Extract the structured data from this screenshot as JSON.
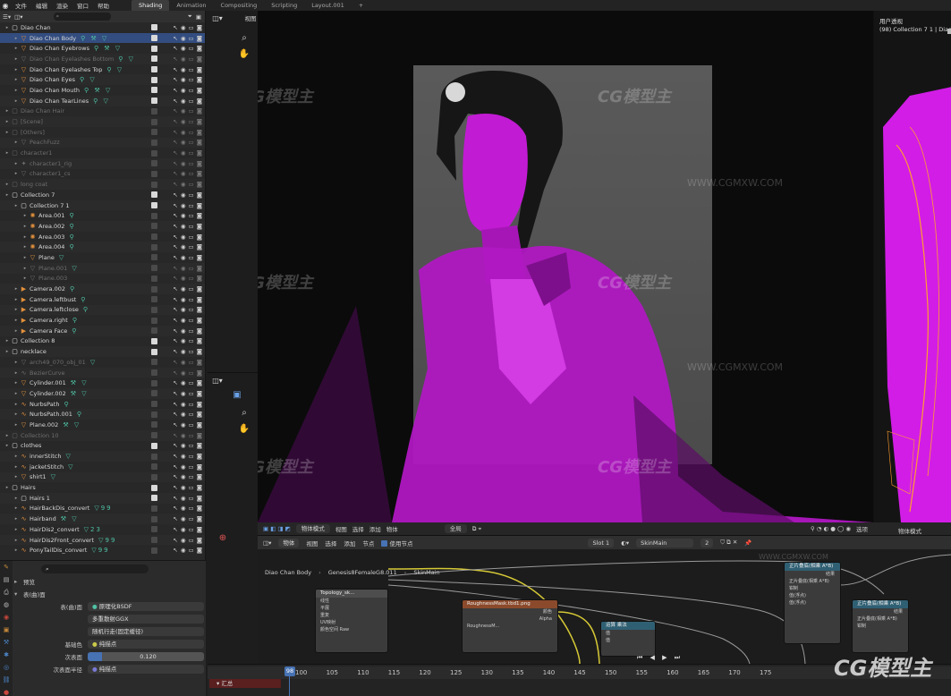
{
  "menu": [
    "文件",
    "编辑",
    "渲染",
    "窗口",
    "帮助"
  ],
  "workspaces": [
    "Shading",
    "Animation",
    "Compositing",
    "Scripting",
    "Layout.001",
    "+"
  ],
  "outliner": {
    "rows": [
      {
        "name": "Diao Chan",
        "level": 0,
        "kind": "collection",
        "dim": false,
        "check": true
      },
      {
        "name": "Diao Chan Body",
        "level": 1,
        "kind": "mesh",
        "dim": false,
        "check": true,
        "selected": true,
        "extras": "⚲ ⚒ ▽"
      },
      {
        "name": "Diao Chan Eyebrows",
        "level": 1,
        "kind": "mesh",
        "dim": false,
        "check": true,
        "extras": "⚲ ⚒ ▽"
      },
      {
        "name": "Diao Chan Eyelashes Bottom",
        "level": 1,
        "kind": "mesh",
        "dim": true,
        "check": true,
        "extras": "⚲ ▽"
      },
      {
        "name": "Diao Chan Eyelashes Top",
        "level": 1,
        "kind": "mesh",
        "dim": false,
        "check": true,
        "extras": "⚲ ▽"
      },
      {
        "name": "Diao Chan Eyes",
        "level": 1,
        "kind": "mesh",
        "dim": false,
        "check": true,
        "extras": "⚲ ▽"
      },
      {
        "name": "Diao Chan Mouth",
        "level": 1,
        "kind": "mesh",
        "dim": false,
        "check": true,
        "extras": "⚲ ⚒ ▽"
      },
      {
        "name": "Diao Chan TearLines",
        "level": 1,
        "kind": "mesh",
        "dim": false,
        "check": true,
        "extras": "⚲ ▽"
      },
      {
        "name": "Diao Chan Hair",
        "level": 0,
        "kind": "collection",
        "dim": true,
        "check": false
      },
      {
        "name": "[Scene]",
        "level": 0,
        "kind": "collection",
        "dim": true,
        "check": false
      },
      {
        "name": "[Others]",
        "level": 0,
        "kind": "collection",
        "dim": true,
        "check": false
      },
      {
        "name": "PeachFuzz",
        "level": 1,
        "kind": "mesh",
        "dim": true,
        "check": false
      },
      {
        "name": "character1",
        "level": 0,
        "kind": "collection",
        "dim": true,
        "check": false
      },
      {
        "name": "character1_rig",
        "level": 1,
        "kind": "armature",
        "dim": true,
        "check": false
      },
      {
        "name": "character1_cs",
        "level": 1,
        "kind": "mesh",
        "dim": true,
        "check": false
      },
      {
        "name": "long coat",
        "level": 0,
        "kind": "collection",
        "dim": true,
        "check": false
      },
      {
        "name": "Collection 7",
        "level": 0,
        "kind": "collection",
        "dim": false,
        "check": true
      },
      {
        "name": "Collection 7 1",
        "level": 1,
        "kind": "collection",
        "dim": false,
        "check": true
      },
      {
        "name": "Area.001",
        "level": 2,
        "kind": "light",
        "dim": false,
        "check": false,
        "extras": "⚲"
      },
      {
        "name": "Area.002",
        "level": 2,
        "kind": "light",
        "dim": false,
        "check": false,
        "extras": "⚲"
      },
      {
        "name": "Area.003",
        "level": 2,
        "kind": "light",
        "dim": false,
        "check": false,
        "extras": "⚲"
      },
      {
        "name": "Area.004",
        "level": 2,
        "kind": "light",
        "dim": false,
        "check": false,
        "extras": "⚲"
      },
      {
        "name": "Plane",
        "level": 2,
        "kind": "mesh",
        "dim": false,
        "check": false,
        "extras": "▽"
      },
      {
        "name": "Plane.001",
        "level": 2,
        "kind": "mesh",
        "dim": true,
        "check": false,
        "extras": "▽"
      },
      {
        "name": "Plane.003",
        "level": 2,
        "kind": "mesh",
        "dim": true,
        "check": false
      },
      {
        "name": "Camera.002",
        "level": 1,
        "kind": "camera",
        "dim": false,
        "check": false,
        "extras": "⚲"
      },
      {
        "name": "Camera.leftbust",
        "level": 1,
        "kind": "camera",
        "dim": false,
        "check": false,
        "extras": "⚲"
      },
      {
        "name": "Camera.leftclose",
        "level": 1,
        "kind": "camera",
        "dim": false,
        "check": false,
        "extras": "⚲"
      },
      {
        "name": "Camera.right",
        "level": 1,
        "kind": "camera",
        "dim": false,
        "check": false,
        "extras": "⚲"
      },
      {
        "name": "Camera Face",
        "level": 1,
        "kind": "camera",
        "dim": false,
        "check": false,
        "extras": "⚲"
      },
      {
        "name": "Collection 8",
        "level": 0,
        "kind": "collection",
        "dim": false,
        "check": true
      },
      {
        "name": "necklace",
        "level": 0,
        "kind": "collection",
        "dim": false,
        "check": true
      },
      {
        "name": "arch49_070_obj_01",
        "level": 1,
        "kind": "mesh",
        "dim": true,
        "check": false,
        "extras": "▽"
      },
      {
        "name": "BezierCurve",
        "level": 1,
        "kind": "curve",
        "dim": true,
        "check": false
      },
      {
        "name": "Cylinder.001",
        "level": 1,
        "kind": "mesh",
        "dim": false,
        "check": false,
        "extras": "⚒ ▽"
      },
      {
        "name": "Cylinder.002",
        "level": 1,
        "kind": "mesh",
        "dim": false,
        "check": false,
        "extras": "⚒ ▽"
      },
      {
        "name": "NurbsPath",
        "level": 1,
        "kind": "curve",
        "dim": false,
        "check": false,
        "extras": "⚲"
      },
      {
        "name": "NurbsPath.001",
        "level": 1,
        "kind": "curve",
        "dim": false,
        "check": false,
        "extras": "⚲"
      },
      {
        "name": "Plane.002",
        "level": 1,
        "kind": "mesh",
        "dim": false,
        "check": false,
        "extras": "⚒ ▽"
      },
      {
        "name": "Collection 10",
        "level": 0,
        "kind": "collection",
        "dim": true,
        "check": false
      },
      {
        "name": "clothes",
        "level": 0,
        "kind": "collection",
        "dim": false,
        "check": true
      },
      {
        "name": "innerStitch",
        "level": 1,
        "kind": "curve",
        "dim": false,
        "check": false,
        "extras": "▽"
      },
      {
        "name": "jacketStitch",
        "level": 1,
        "kind": "curve",
        "dim": false,
        "check": false,
        "extras": "▽"
      },
      {
        "name": "shirt1",
        "level": 1,
        "kind": "mesh",
        "dim": false,
        "check": false,
        "extras": "▽"
      },
      {
        "name": "Hairs",
        "level": 0,
        "kind": "collection",
        "dim": false,
        "check": true
      },
      {
        "name": "Hairs 1",
        "level": 1,
        "kind": "collection",
        "dim": false,
        "check": true
      },
      {
        "name": "HairBackDis_convert",
        "level": 1,
        "kind": "curve",
        "dim": false,
        "check": false,
        "extras": "▽99"
      },
      {
        "name": "Hairband",
        "level": 1,
        "kind": "curve",
        "dim": false,
        "check": false,
        "extras": "⚒ ▽"
      },
      {
        "name": "HairDis2_convert",
        "level": 1,
        "kind": "curve",
        "dim": false,
        "check": false,
        "extras": "▽23"
      },
      {
        "name": "HairDis2Front_convert",
        "level": 1,
        "kind": "curve",
        "dim": false,
        "check": false,
        "extras": "▽99"
      },
      {
        "name": "PonyTailDis_convert",
        "level": 1,
        "kind": "curve",
        "dim": false,
        "check": false,
        "extras": "▽99"
      }
    ]
  },
  "properties": {
    "panel_preview": "预览",
    "panel_surface": "表(曲)面",
    "surface_label": "表(曲)面",
    "surface_value": "原理化BSDF",
    "distribution": "多重散射GGX",
    "subsurface_method": "随机行走(固定缓径)",
    "base_color_label": "基础色",
    "base_color_value": "纯描点",
    "subsurface_label": "次表面",
    "subsurface_value": "0.120",
    "subsurface_fraction": 0.12,
    "subsurface_radius_label": "次表面半径",
    "subsurface_radius_value": "纯描点"
  },
  "viewport": {
    "mode_label": "视图",
    "header_items": [
      "物体模式",
      "视图",
      "选择",
      "添加",
      "物体",
      "全局"
    ],
    "right_title": "用户透视",
    "right_subtitle": "(98) Collection 7 1 | Diao Ch",
    "right_header": "物体模式",
    "select_label": "选项"
  },
  "node_editor": {
    "header_items": [
      "物体",
      "视图",
      "选择",
      "添加",
      "节点",
      "使用节点"
    ],
    "slot": "Slot 1",
    "material": "SkinMain",
    "user_count": "2",
    "breadcrumb": [
      "Diao Chan Body",
      "Genesis8FemaleG8.011",
      "SkinMain"
    ],
    "nodes": [
      {
        "title": "Topology_sk...",
        "color": "#4d4d4d",
        "rows": [
          "线性",
          "平展",
          "重复",
          "UV映射",
          "颜色空间 Raw"
        ]
      },
      {
        "title": "RoughnessMask.tbd1.png",
        "color": "#8b4a2b",
        "rows": [
          "颜色",
          "Alpha",
          "RoughnessM..."
        ]
      },
      {
        "title": "运算 乘法",
        "color": "#2f5f73",
        "rows": [
          "值",
          "值"
        ]
      },
      {
        "title": "正片叠底(相乘 A*B)",
        "color": "#2f5f73",
        "rows": [
          "结果",
          "正片叠底(相乘 A*B)",
          "钳制",
          "值(浮点)",
          "值(浮点)"
        ]
      },
      {
        "title": "正片叠底(相乘 A*B)",
        "color": "#2f5f73",
        "rows": [
          "结果",
          "正片叠底(相乘 A*B)",
          "钳制"
        ]
      }
    ]
  },
  "timeline": {
    "current_frame": "98",
    "ticks": [
      "100",
      "105",
      "110",
      "115",
      "120",
      "125",
      "130",
      "135",
      "140",
      "145",
      "150",
      "155",
      "160",
      "165",
      "170",
      "175"
    ],
    "summary_label": "汇总"
  },
  "watermark": {
    "logo": "CG模型主",
    "url": "WWW.CGMXW.COM"
  },
  "colors": {
    "accent": "#4772b3",
    "selection": "#334d80",
    "magenta": "#c21bd4",
    "wire_yellow": "#d6c936",
    "wire_gray": "#9a9a9a"
  }
}
